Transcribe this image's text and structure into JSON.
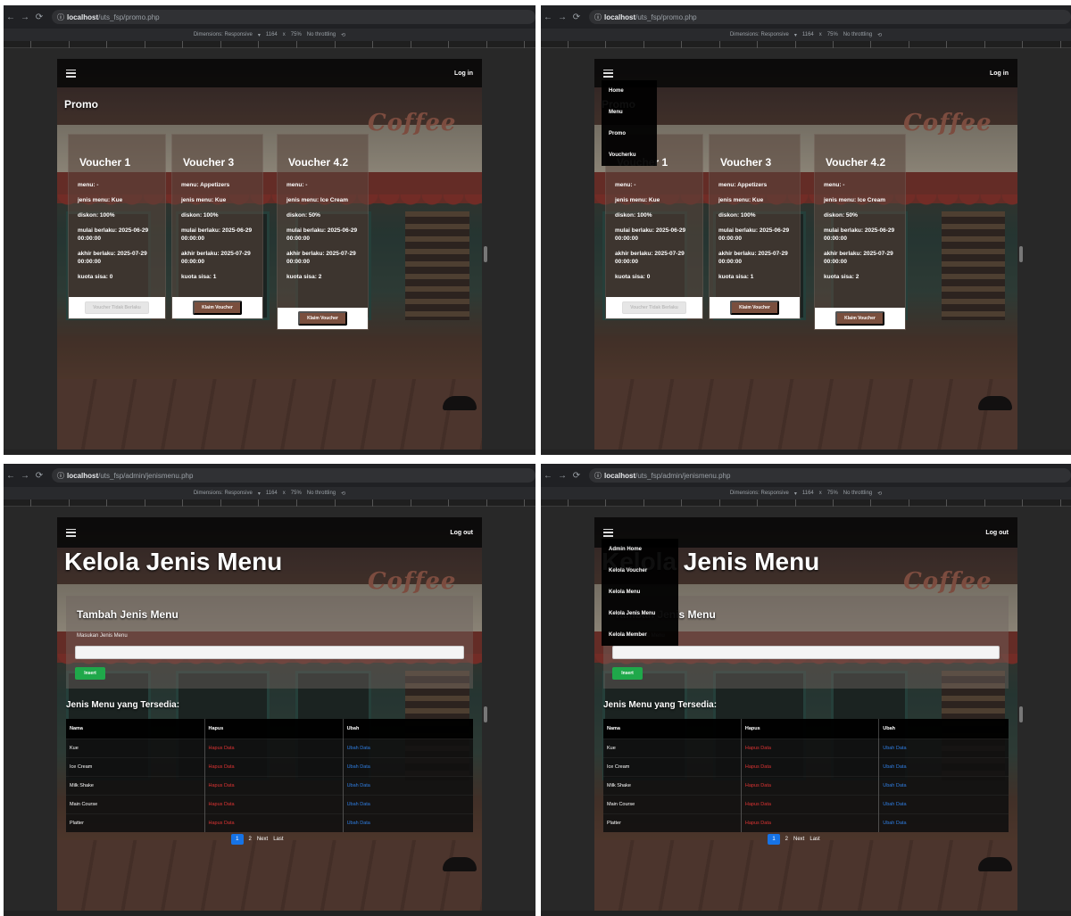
{
  "browser": {
    "host": "localhost",
    "promo_path": "/uts_fsp/promo.php",
    "admin_path": "/uts_fsp/admin/jenismenu.php"
  },
  "devtools": {
    "dimensions_label": "Dimensions: Responsive",
    "width": "1164",
    "times": "x",
    "zoom": "75%",
    "throttle": "No throttling"
  },
  "promo_page": {
    "login_label": "Log in",
    "title": "Promo",
    "sign": "Coffee",
    "menu_items": [
      "Home",
      "Menu",
      "Promo",
      "Voucherku"
    ],
    "vouchers": [
      {
        "name": "Voucher 1",
        "lines": [
          "menu: -",
          "jenis menu: Kue",
          "diskon: 100%",
          "mulai berlaku: 2025-06-29 00:00:00",
          "akhir berlaku: 2025-07-29 00:00:00",
          "kuota sisa: 0"
        ],
        "button": "Voucher Tidak Berlaku",
        "disabled": true
      },
      {
        "name": "Voucher 3",
        "lines": [
          "menu: Appetizers",
          "jenis menu: Kue",
          "diskon: 100%",
          "mulai berlaku: 2025-06-29 00:00:00",
          "akhir berlaku: 2025-07-29 00:00:00",
          "kuota sisa: 1"
        ],
        "button": "Klaim Voucher",
        "disabled": false
      },
      {
        "name": "Voucher 4.2",
        "lines": [
          "menu: -",
          "jenis menu: Ice Cream",
          "diskon: 50%",
          "mulai berlaku: 2025-06-29 00:00:00",
          "akhir berlaku: 2025-07-29 00:00:00",
          "kuota sisa: 2"
        ],
        "button": "Klaim Voucher",
        "disabled": false
      }
    ]
  },
  "admin_page": {
    "logout_label": "Log out",
    "title": "Kelola Jenis Menu",
    "sign": "Coffee",
    "menu_items": [
      "Admin Home",
      "Kelola Voucher",
      "Kelola Menu",
      "Kelola Jenis Menu",
      "Kelola Member"
    ],
    "form_title": "Tambah Jenis Menu",
    "input_label": "Masukan Jenis Menu",
    "insert_label": "Insert",
    "list_title": "Jenis Menu yang Tersedia:",
    "columns": [
      "Nama",
      "Hapus",
      "Ubah"
    ],
    "rows": [
      {
        "nama": "Kue",
        "hapus": "Hapus Data",
        "ubah": "Ubah Data"
      },
      {
        "nama": "Ice Cream",
        "hapus": "Hapus Data",
        "ubah": "Ubah Data"
      },
      {
        "nama": "Milk Shake",
        "hapus": "Hapus Data",
        "ubah": "Ubah Data"
      },
      {
        "nama": "Main Course",
        "hapus": "Hapus Data",
        "ubah": "Ubah Data"
      },
      {
        "nama": "Platter",
        "hapus": "Hapus Data",
        "ubah": "Ubah Data"
      }
    ],
    "pager": [
      "1",
      "2",
      "Next",
      "Last"
    ]
  },
  "colors": {
    "active_page": "#1673e6",
    "insert_button": "#1fa84a",
    "hapus_link": "#dd3333",
    "ubah_link": "#2f7de1",
    "klaim_button": "#7a4f3e"
  }
}
